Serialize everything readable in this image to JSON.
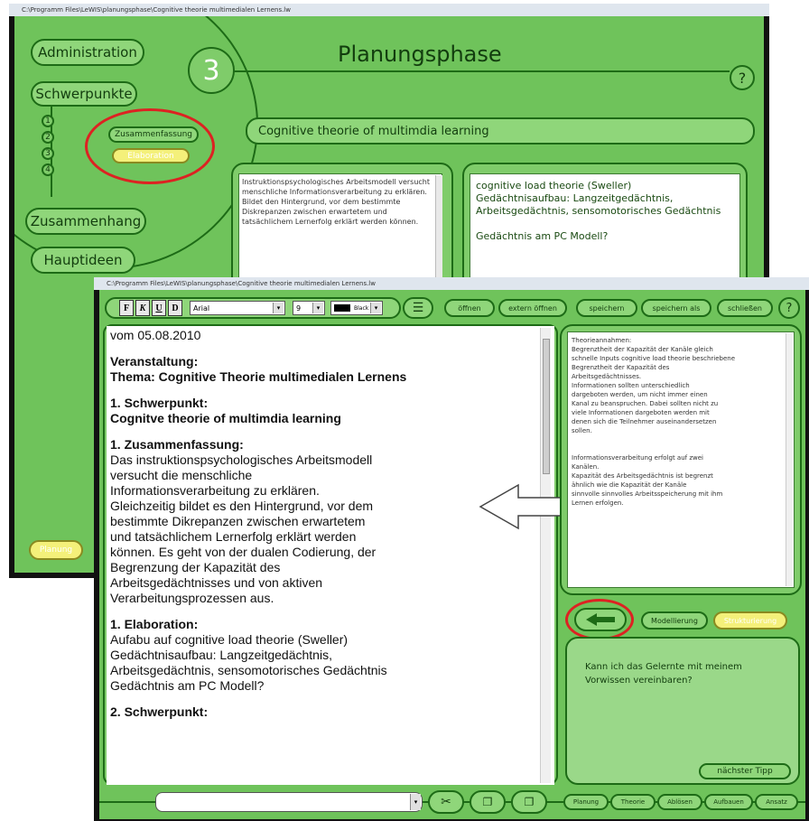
{
  "back_window": {
    "title": "C:\\Programm Files\\LeWIS\\planungsphase\\Cognitive theorie multimedialen Lernens.lw",
    "sidebar": {
      "administration": "Administration",
      "schwerpunkte": "Schwerpunkte",
      "numbers": [
        "1",
        "2",
        "3",
        "4"
      ],
      "zusammenfassung": "Zusammenfassung",
      "elaboration": "Elaboration",
      "zusammenhang": "Zusammenhang",
      "hauptideen": "Hauptideen",
      "bottom_button": "Planung"
    },
    "phase_number": "3",
    "phase_title": "Planungsphase",
    "help": "?",
    "topic": "Cognitive theorie of multimdia learning",
    "left_text": "Instruktionspsychologisches Arbeitsmodell versucht menschliche Informationsverarbeitung zu erklären. Bildet den Hintergrund, vor dem bestimmte Diskrepanzen zwischen erwartetem und tatsächlichem Lernerfolg erklärt werden können.",
    "right_text": [
      "cognitive load theorie (Sweller)",
      "Gedächtnisaufbau: Langzeitgedächtnis,",
      "Arbeitsgedächtnis, sensomotorisches Gedächtnis",
      "",
      "Gedächtnis am PC Modell?"
    ]
  },
  "front_window": {
    "title": "C:\\Programm Files\\LeWIS\\planungsphase\\Cognitive theorie multimedialen Lernens.lw",
    "format_buttons": [
      "F",
      "K",
      "U",
      "D"
    ],
    "font_select": "Arial",
    "size_select": "9",
    "color_select": "Black",
    "toolbar_buttons": [
      "öffnen",
      "extern öffnen",
      "speichern",
      "speichern als",
      "schließen"
    ],
    "help": "?",
    "document": {
      "date": "vom 05.08.2010",
      "veranstaltung_label": "Veranstaltung:",
      "thema": "Thema: Cognitive Theorie multimedialen Lernens",
      "schwerpunkt_label": "1. Schwerpunkt:",
      "schwerpunkt_value": "Cognitve theorie of multimdia learning",
      "zusammenfassung_label": "1. Zusammenfassung:",
      "zusammenfassung_lines": [
        "Das instruktionspsychologisches Arbeitsmodell",
        "versucht die menschliche",
        "Informationsverarbeitung zu erklären.",
        "Gleichzeitig bildet es den Hintergrund, vor dem",
        "bestimmte  Dikrepanzen zwischen erwartetem",
        "und tatsächlichem Lernerfolg erklärt werden",
        "können. Es geht von der dualen Codierung, der",
        "Begrenzung  der Kapazität des",
        "Arbeitsgedächtnisses und von aktiven",
        "Verarbeitungsprozessen aus."
      ],
      "elaboration_label": "1. Elaboration:",
      "elaboration_lines": [
        "Aufabu auf cognitive load theorie (Sweller)",
        "Gedächtnisaufbau: Langzeitgedächtnis,",
        "Arbeitsgedächtnis, sensomotorisches Gedächtnis",
        "Gedächtnis am PC Modell?"
      ],
      "next_label": "2. Schwerpunkt:"
    },
    "side_text_lines": [
      "Theorieannahmen:",
      "Begrenztheit der Kapazität der Kanäle gleich",
      "schnelle Inputs cognitive load theorie beschriebene",
      "Begrenztheit der Kapazität des",
      "Arbeitsgedächtnisses.",
      "Informationen sollten unterschiedlich",
      "dargeboten werden, um nicht immer einen",
      "Kanal zu beanspruchen. Dabei sollten nicht zu",
      "viele Informationen dargeboten werden mit",
      "denen sich die Teilnehmer auseinandersetzen",
      "sollen.",
      "",
      "",
      "Informationsverarbeitung erfolgt auf zwei",
      "Kanälen.",
      "Kapazität des Arbeitsgedächtnis ist begrenzt",
      "ähnlich wie die Kapazität der Kanäle",
      "sinnvolle sinnvolles Arbeitsspeicherung mit ihm",
      "Lernen erfolgen."
    ],
    "modellierung": "Modellierung",
    "strukturierung": "Strukturierung",
    "question": "Kann ich das Gelernte mit meinem Vorwissen vereinbaren?",
    "next_tip": "nächster Tipp",
    "bottom_select": "",
    "phase_buttons": [
      "Planung",
      "Theorie",
      "Ablösen",
      "Aufbauen",
      "Ansatz"
    ]
  },
  "colors": {
    "panel_green": "#6fc35b",
    "pill_green": "#8fd67a",
    "dark_green": "#1d6b16",
    "highlight_yellow": "#f4f07a",
    "annotation_red": "#dd2222"
  }
}
